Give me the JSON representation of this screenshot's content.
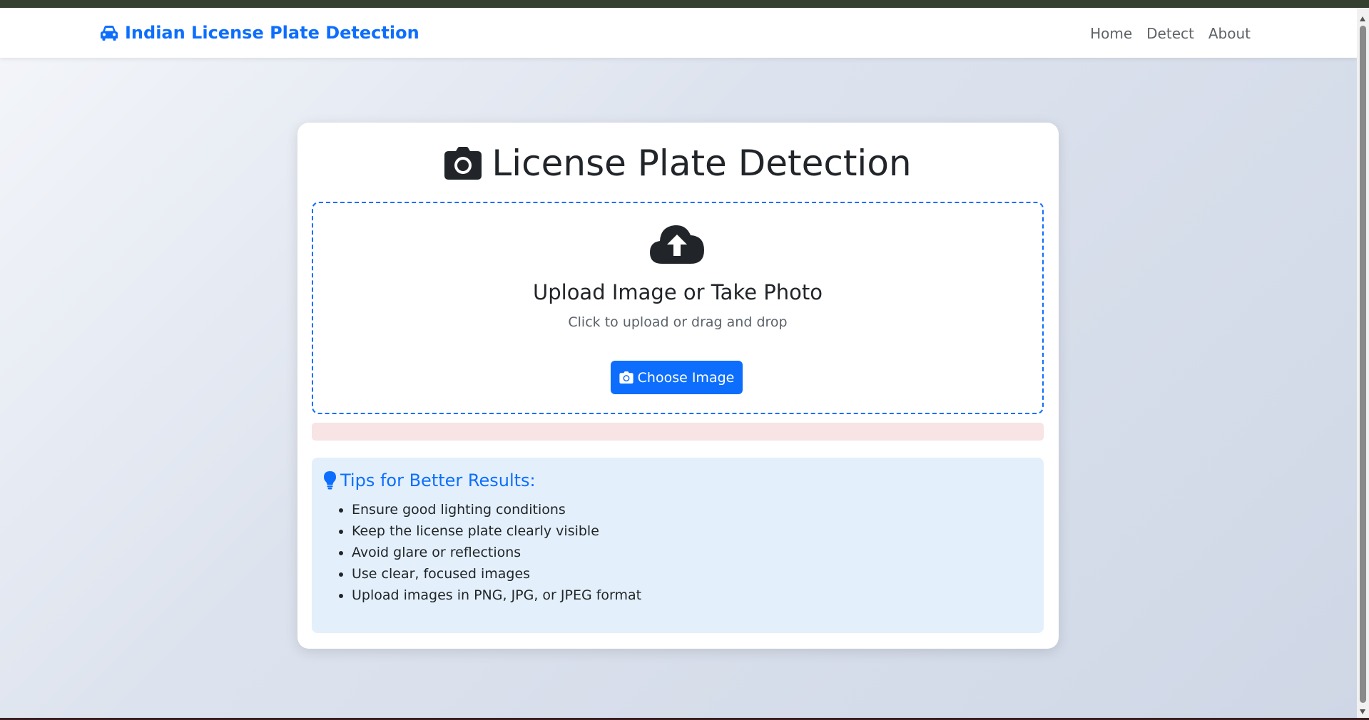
{
  "navbar": {
    "brand": "Indian License Plate Detection",
    "links": [
      "Home",
      "Detect",
      "About"
    ]
  },
  "card": {
    "title": "License Plate Detection",
    "upload": {
      "title": "Upload Image or Take Photo",
      "subtitle": "Click to upload or drag and drop",
      "button_label": "Choose Image"
    },
    "tips": {
      "title": "Tips for Better Results:",
      "items": [
        "Ensure good lighting conditions",
        "Keep the license plate clearly visible",
        "Avoid glare or reflections",
        "Use clear, focused images",
        "Upload images in PNG, JPG, or JPEG format"
      ]
    }
  },
  "icons": {
    "brand": "car-icon",
    "title": "camera-icon",
    "upload": "cloud-upload-icon",
    "button": "camera-icon",
    "tips": "lightbulb-icon"
  },
  "colors": {
    "accent": "#0d6efd",
    "tips_background": "#e3f0fc",
    "alert_background": "#f8e3e5"
  }
}
